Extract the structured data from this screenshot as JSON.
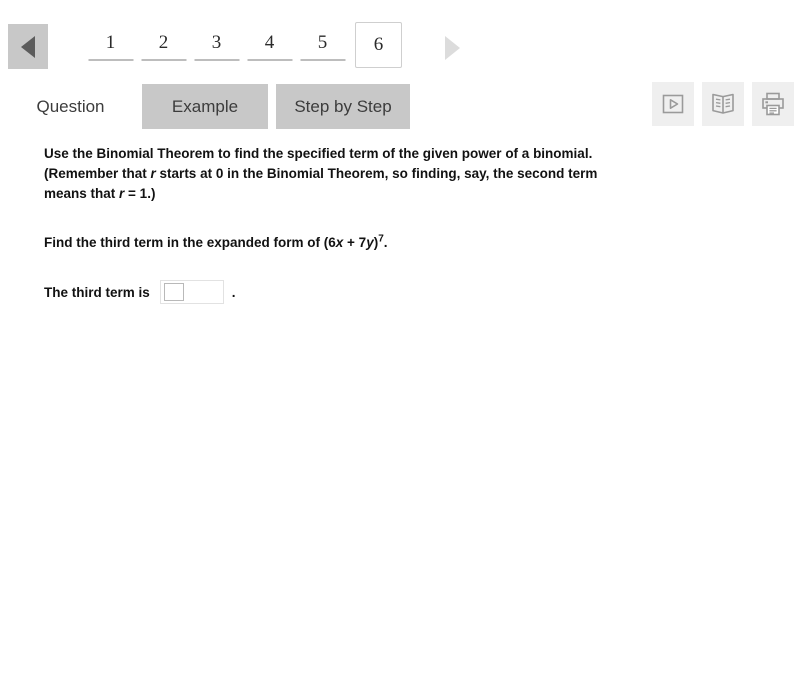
{
  "pager": {
    "prev_label": "previous",
    "next_label": "next",
    "pages": [
      {
        "label": "1",
        "current": false
      },
      {
        "label": "2",
        "current": false
      },
      {
        "label": "3",
        "current": false
      },
      {
        "label": "4",
        "current": false
      },
      {
        "label": "5",
        "current": false
      },
      {
        "label": "6",
        "current": true
      }
    ],
    "current_page": "6"
  },
  "tabs": [
    {
      "label": "Question",
      "active": true
    },
    {
      "label": "Example",
      "active": false
    },
    {
      "label": "Step by Step",
      "active": false
    }
  ],
  "tools": [
    {
      "name": "video-icon",
      "label": "Video"
    },
    {
      "name": "textbook-icon",
      "label": "Textbook"
    },
    {
      "name": "print-icon",
      "label": "Print"
    }
  ],
  "question": {
    "instructions_line1": "Use the Binomial Theorem to find the specified term of the given power of a binomial.",
    "instructions_line2_a": "(Remember that ",
    "instructions_line2_r": "r",
    "instructions_line2_b": " starts at 0 in the Binomial Theorem, so finding, say, the second term",
    "instructions_line3_a": "means that ",
    "instructions_line3_r": "r",
    "instructions_line3_b": " = 1.)",
    "problem_a": "Find the third term in the expanded form of (6",
    "problem_x": "x",
    "problem_b": " + 7",
    "problem_y": "y",
    "problem_c": ")",
    "problem_exp": "7",
    "problem_d": ".",
    "answer_prompt": "The third term is",
    "answer_value": "",
    "answer_placeholder": "",
    "answer_period": "."
  },
  "colors": {
    "button_gray": "#c8c8c8",
    "tool_gray": "#efefef",
    "icon_stroke": "#9a9a9a",
    "text": "#121212",
    "rule_gray": "#bdbdbd"
  }
}
